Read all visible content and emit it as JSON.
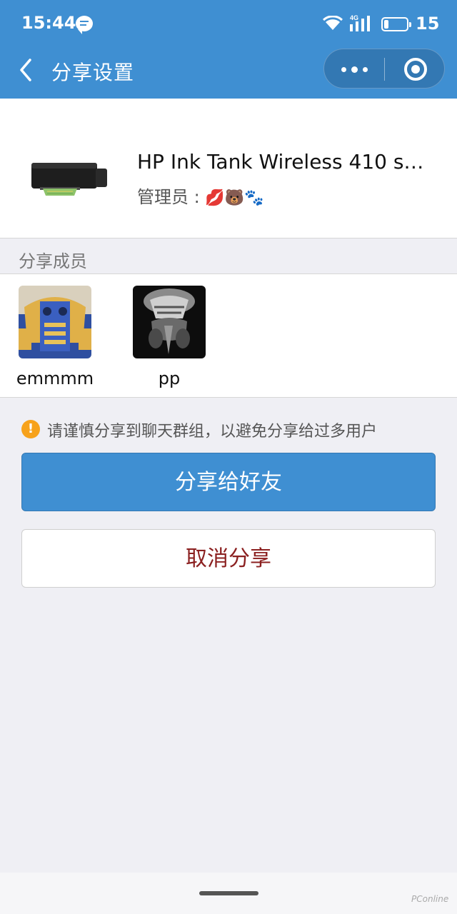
{
  "status_bar": {
    "time": "15:44",
    "battery_level": "15",
    "network_label": "4G",
    "icons": [
      "chat-icon",
      "wifi-icon",
      "signal-icon",
      "battery-icon"
    ]
  },
  "nav": {
    "title": "分享设置",
    "back_icon": "chevron-left-icon",
    "more_icon": "more-dots-icon",
    "close_icon": "target-close-icon"
  },
  "device": {
    "name": "HP Ink Tank Wireless 410 s…",
    "admin_label": "管理员 :",
    "admin_emojis": "💋🐻🐾"
  },
  "members_section": {
    "title": "分享成员",
    "members": [
      {
        "name": "emmmm"
      },
      {
        "name": "pp"
      }
    ]
  },
  "notice": {
    "icon": "warning-icon",
    "text": "请谨慎分享到聊天群组，以避免分享给过多用户"
  },
  "buttons": {
    "share": "分享给好友",
    "cancel": "取消分享"
  },
  "watermark": "PConline",
  "colors": {
    "primary": "#3f8fd2",
    "cancel_text": "#8b2020",
    "warning": "#f7a21b",
    "background": "#efeff4"
  }
}
